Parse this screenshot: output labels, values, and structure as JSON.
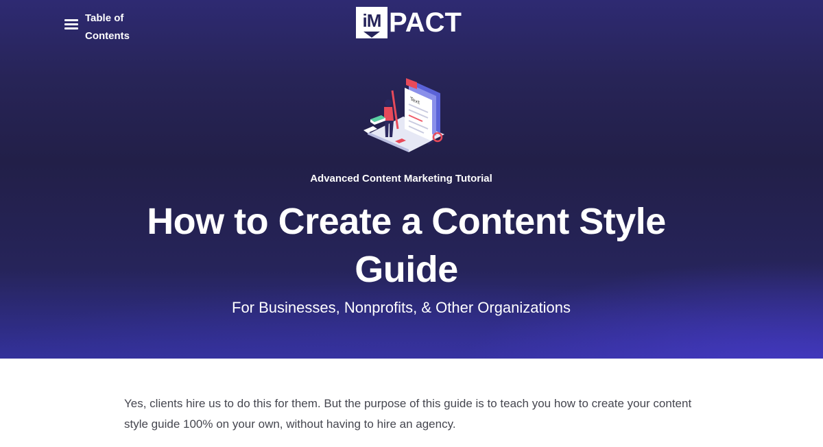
{
  "nav": {
    "toc_label": "Table of Contents"
  },
  "logo": {
    "badge_text": "iM",
    "rest_text": "PACT"
  },
  "hero": {
    "eyebrow": "Advanced Content Marketing Tutorial",
    "title": "How to Create a Content Style Guide",
    "subtitle": "For Businesses, Nonprofits, & Other Organizations",
    "illustration_icon": "content-writing-illustration",
    "illustration_text": "Text"
  },
  "body": {
    "intro": "Yes, clients hire us to do this for them. But the purpose of this guide is to teach you how to create your content style guide 100% on your own, without having to hire an agency."
  },
  "colors": {
    "hero_dark": "#221f48",
    "hero_accent": "#33319a",
    "body_text": "#45464f",
    "white": "#ffffff"
  }
}
